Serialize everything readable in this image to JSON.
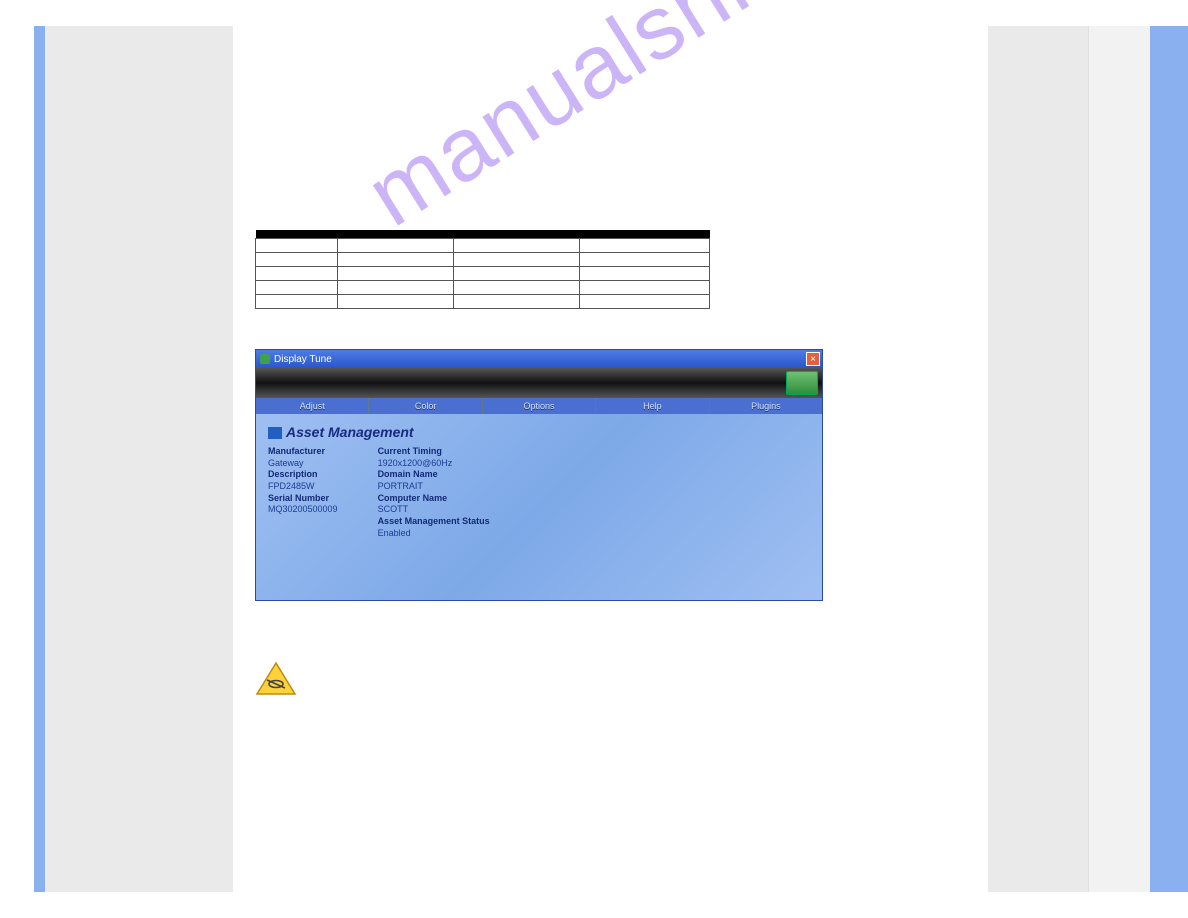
{
  "watermark": "manualshive.com",
  "table": {
    "headers": [
      "",
      "",
      "",
      ""
    ],
    "rows": [
      [
        "",
        "",
        "",
        ""
      ],
      [
        "",
        "",
        "",
        ""
      ],
      [
        "",
        "",
        "",
        ""
      ],
      [
        "",
        "",
        "",
        ""
      ],
      [
        "",
        "",
        "",
        ""
      ]
    ]
  },
  "app": {
    "title": "Display Tune",
    "tabs": [
      "Adjust",
      "Color",
      "Options",
      "Help",
      "Plugins"
    ],
    "panelTitle": "Asset Management",
    "left": {
      "manufacturerLabel": "Manufacturer",
      "manufacturerValue": "Gateway",
      "descriptionLabel": "Description",
      "descriptionValue": "FPD2485W",
      "serialLabel": "Serial Number",
      "serialValue": "MQ30200500009"
    },
    "right": {
      "timingLabel": "Current Timing",
      "timingValue": "1920x1200@60Hz",
      "domainLabel": "Domain Name",
      "domainValue": "PORTRAIT",
      "computerLabel": "Computer Name",
      "computerValue": "SCOTT",
      "statusLabel": "Asset Management Status",
      "statusValue": "Enabled"
    }
  }
}
